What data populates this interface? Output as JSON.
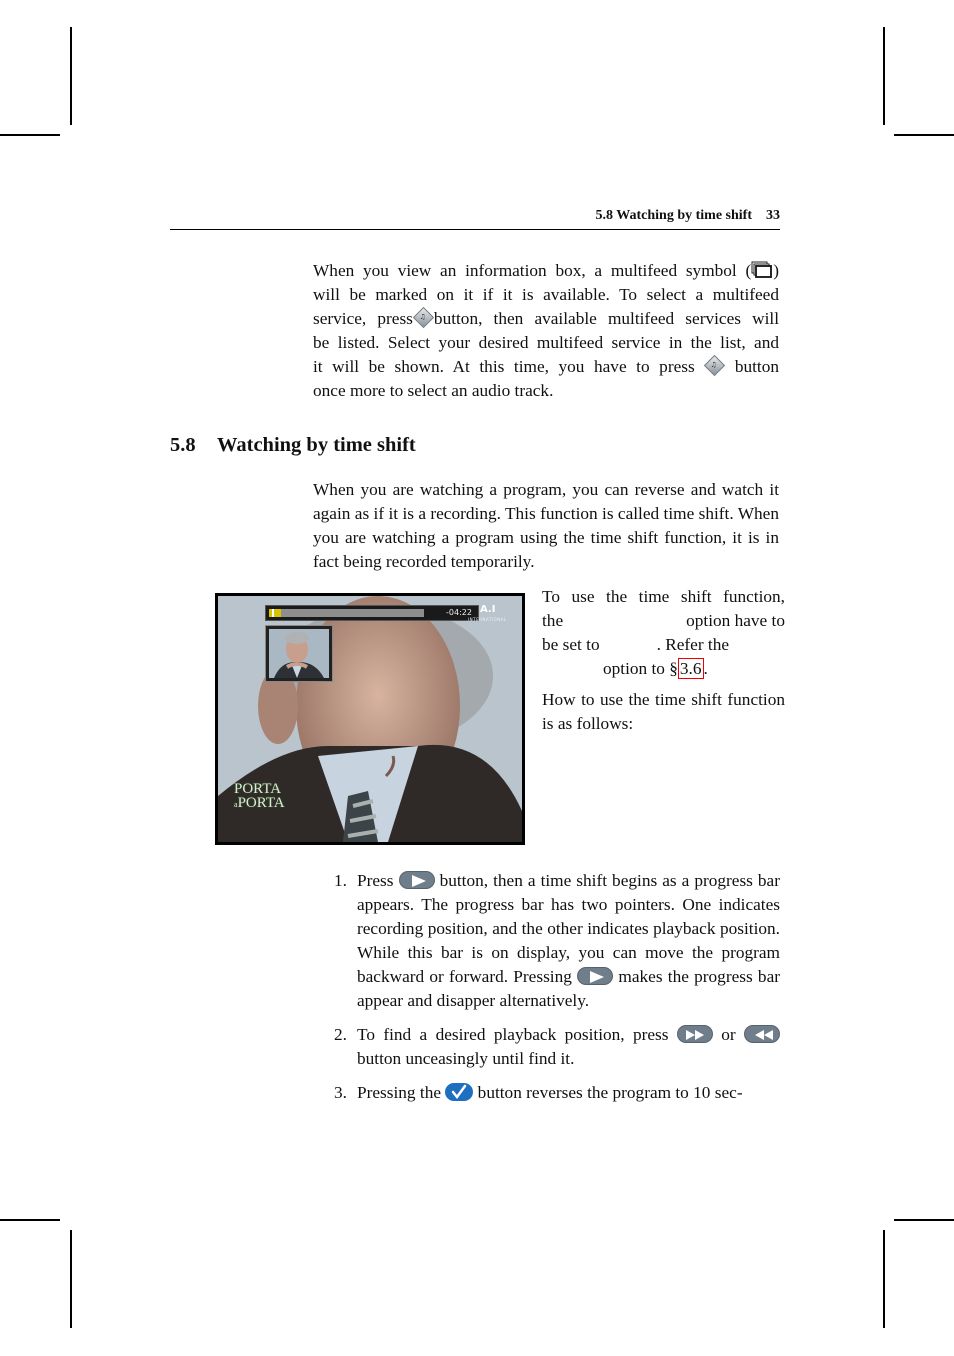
{
  "header": {
    "section_title": "5.8 Watching by time shift",
    "page_number": "33"
  },
  "intro": {
    "line1": "When you view an information box, a multifeed symbol (",
    "line1_end": ")",
    "line2": "will be marked on it if it is available.  To select a multifeed",
    "line3a": "service, press",
    "line3b": "button, then available multifeed services will",
    "line4": "be listed. Select your desired multifeed service in the list, and",
    "line5a": "it will be shown.  At this time, you have to press",
    "line5b": "button",
    "line6": "once more to select an audio track.",
    "audio_button_glyph": "♫"
  },
  "section": {
    "number": "5.8",
    "title": "Watching by time shift"
  },
  "body_paragraph": "When you are watching a program, you can reverse and watch it again as if it is a recording. This function is called time shift. When you are watching a program using the time shift function, it is in fact being recorded temporarily.",
  "screenshot": {
    "time_remaining": "-04:22",
    "progress_fraction": 0.08,
    "channel_logo": "A.I",
    "channel_sub": "INTERNATIONAL",
    "show_logo_line1": "PORTA",
    "show_logo_line2": "PORTA",
    "show_logo_small": "a"
  },
  "side_text": {
    "p1_line1": "To use the time shift function,",
    "p1_line2a": "the",
    "p1_line2b": "option have to",
    "p1_line3a": "be set to",
    "p1_line3b": ". Refer the",
    "p1_line4": "option to §",
    "p1_ref": "3.6",
    "p1_end": ".",
    "p2": "How to use the time shift function is as follows:"
  },
  "steps": [
    {
      "num": "1.",
      "pre": "Press",
      "mid": "button, then a time shift begins as a progress bar appears. The progress bar has two pointers. One indicates recording position, and the other indicates playback position. While this bar is on display, you can move the program backward or forward. Pressing",
      "post": "makes the progress bar appear and disapper alternatively."
    },
    {
      "num": "2.",
      "pre": "To find a desired playback position, press",
      "mid": "or",
      "post": "button unceasingly until find it."
    },
    {
      "num": "3.",
      "pre": "Pressing the",
      "post": "button reverses the program to 10 sec-"
    }
  ],
  "colors": {
    "remote_gray": "#6f7e8a",
    "remote_blue": "#1f6fc0",
    "link_box": "#e00000",
    "progress_yellow": "#d9c300"
  }
}
